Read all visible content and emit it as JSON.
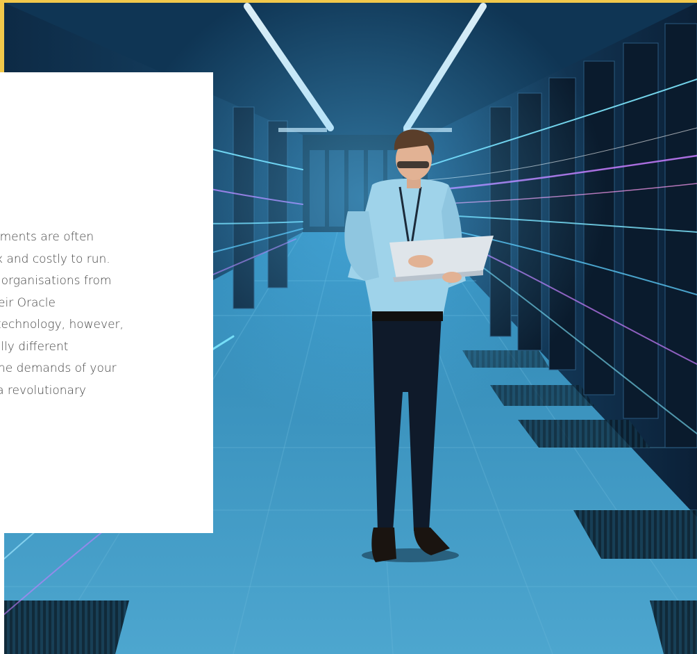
{
  "hero": {
    "scene": "data-center-aisle",
    "colors": {
      "accent": "#f1c84b",
      "cyan": "#7fe9ff",
      "magenta": "#c77dff",
      "deep": "#0d2740"
    }
  },
  "card": {
    "body_text": "Legacy Oracle environments are often cumbersome, complex and costly to run. Such problems hinder organisations from getting more out of their Oracle investments. Modern technology, however, enables a fundamentally different architecture to meet the demands of your business and creates a revolutionary"
  }
}
